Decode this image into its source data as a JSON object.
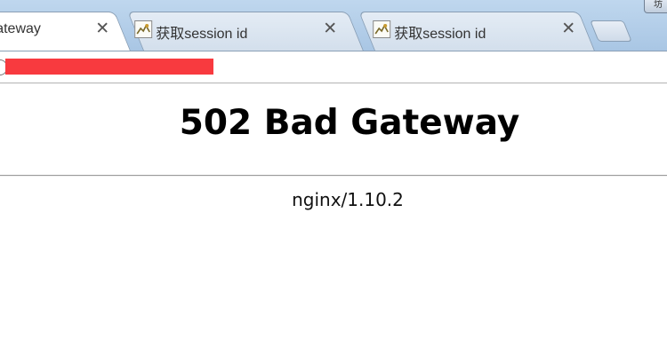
{
  "browser": {
    "tabs": [
      {
        "title": "ateway",
        "close": "✕",
        "active": true
      },
      {
        "title": "获取session id",
        "close": "✕",
        "active": false
      },
      {
        "title": "获取session id",
        "close": "✕",
        "active": false
      }
    ],
    "window_button": "坊"
  },
  "page": {
    "heading": "502 Bad Gateway",
    "server": "nginx/1.10.2"
  },
  "colors": {
    "redaction": "#f83a3f",
    "tab_strip": "#bfd7ee"
  },
  "icons": [
    "page-favicon-icon",
    "close-icon",
    "site-info-icon"
  ]
}
